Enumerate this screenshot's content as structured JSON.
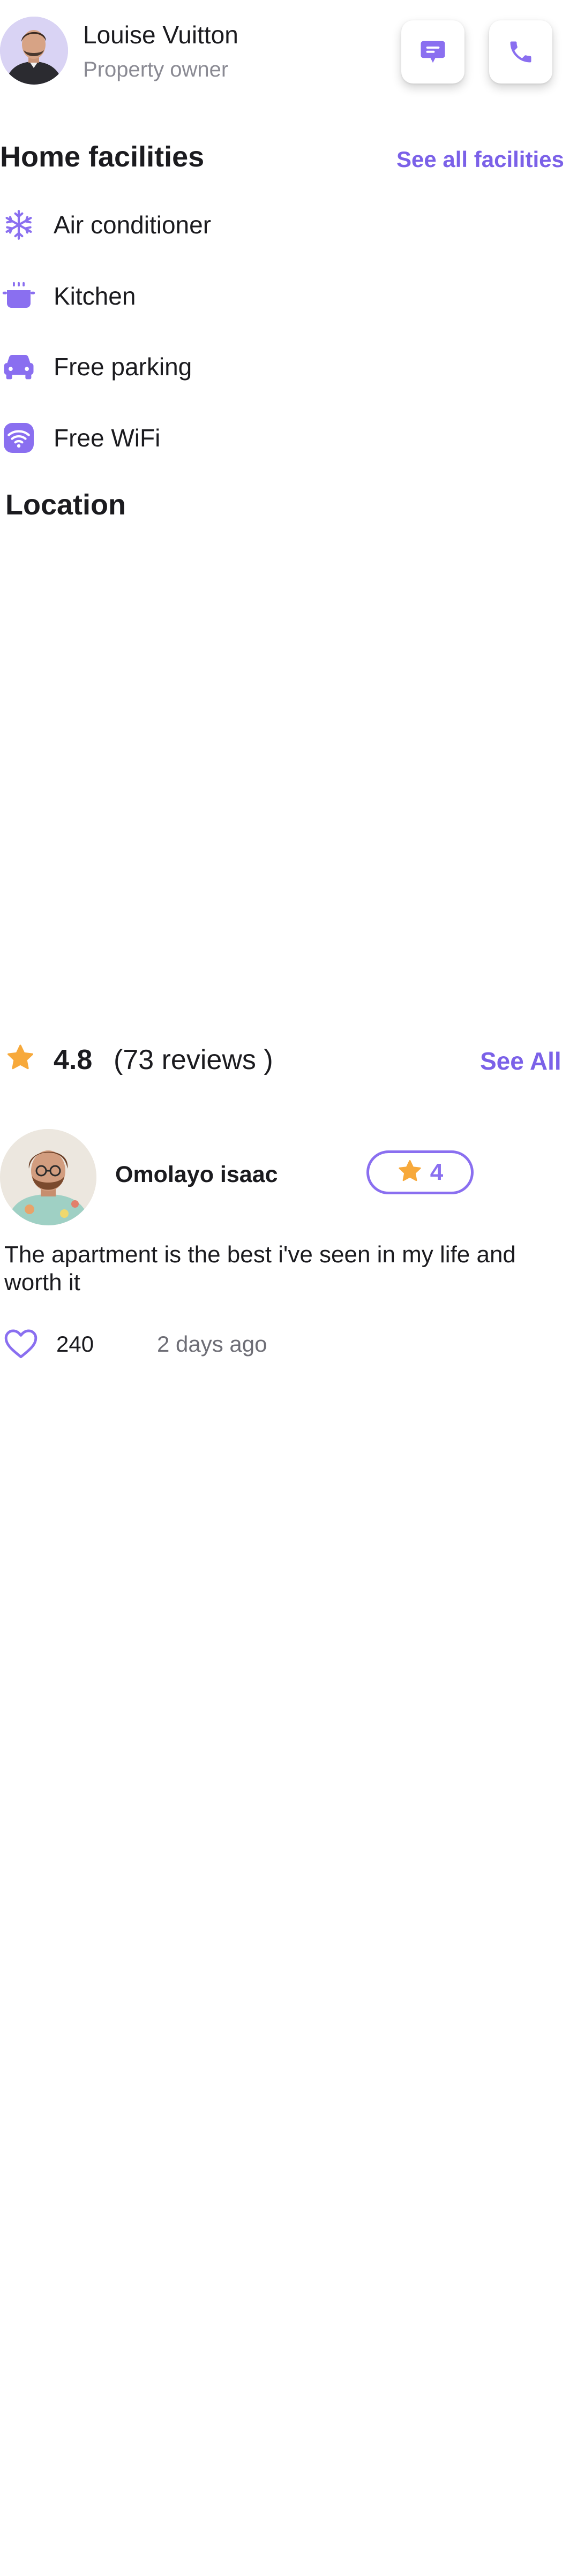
{
  "owner": {
    "name": "Louise Vuitton",
    "role": "Property owner",
    "avatar_icon": "person-avatar"
  },
  "actions": {
    "chat_icon": "chat-icon",
    "call_icon": "phone-icon"
  },
  "facilities": {
    "title": "Home facilities",
    "see_all": "See all facilities",
    "items": [
      {
        "label": "Air conditioner",
        "icon": "snowflake-icon"
      },
      {
        "label": "Kitchen",
        "icon": "cooking-pot-icon"
      },
      {
        "label": "Free parking",
        "icon": "car-icon"
      },
      {
        "label": "Free WiFi",
        "icon": "wifi-icon"
      }
    ]
  },
  "location": {
    "title": "Location"
  },
  "rating": {
    "value": "4.8",
    "count": "(73 reviews )",
    "see_all": "See All"
  },
  "review": {
    "name": "Omolayo isaac",
    "rating": "4",
    "text": "The apartment is the best i've seen in my life and worth it",
    "likes": "240",
    "time": "2 days ago"
  },
  "colors": {
    "accent": "#7b61e8",
    "accent_light": "#8a6ff0",
    "star": "#f7a93b",
    "text": "#1b1b1f",
    "muted": "#8a8a93"
  }
}
